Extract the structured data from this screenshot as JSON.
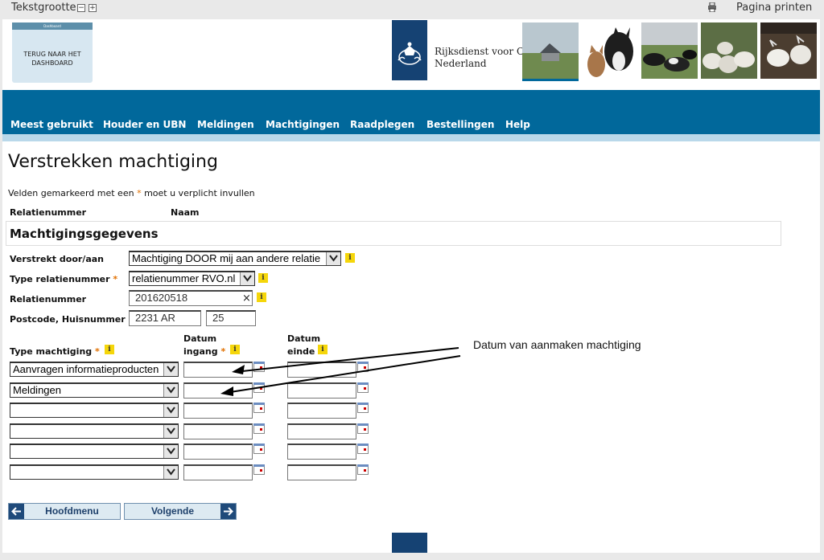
{
  "topbar": {
    "text_size_label": "Tekstgrootte",
    "minus": "−",
    "plus": "+",
    "print_label": "Pagina printen"
  },
  "header": {
    "dashboard_small": "Dashboard",
    "dashboard_label": "TERUG NAAR HET DASHBOARD",
    "logo_line1": "Rijksdienst voor Ond",
    "logo_line2": "Nederland"
  },
  "nav": {
    "items": [
      "Meest gebruikt",
      "Houder en UBN",
      "Meldingen",
      "Machtigingen",
      "Raadplegen",
      "Bestellingen",
      "Help"
    ]
  },
  "form": {
    "title": "Verstrekken machtiging",
    "required_prefix": "Velden gemarkeerd met een",
    "required_star": "*",
    "required_suffix": "moet u verplicht invullen",
    "col_relatienummer": "Relatienummer",
    "col_naam": "Naam",
    "section_title": "Machtigingsgegevens",
    "info_glyph": "i",
    "verstrekt_label": "Verstrekt door/aan",
    "verstrekt_value": "Machtiging DOOR mij aan andere relatie",
    "type_rel_label": "Type relatienummer",
    "type_rel_value": "relatienummer RVO.nl",
    "relnr_label": "Relatienummer",
    "relnr_value": "201620518",
    "clear_glyph": "×",
    "postcode_label": "Postcode, Huisnummer",
    "postcode_value": "2231 AR",
    "huisnummer_value": "25",
    "type_machtiging_label": "Type machtiging",
    "datum_ingang_label1": "Datum",
    "datum_ingang_label2": "ingang",
    "datum_einde_label1": "Datum",
    "datum_einde_label2": "einde",
    "rows": [
      "Aanvragen informatieproducten",
      "Meldingen",
      "",
      "",
      "",
      ""
    ]
  },
  "annotation": {
    "text": "Datum van aanmaken machtiging"
  },
  "buttons": {
    "hoofdmenu": "Hoofdmenu",
    "volgende": "Volgende"
  },
  "colors": {
    "nav": "#01689b",
    "logo": "#154273",
    "star": "#e17000",
    "info": "#f5d60a"
  }
}
